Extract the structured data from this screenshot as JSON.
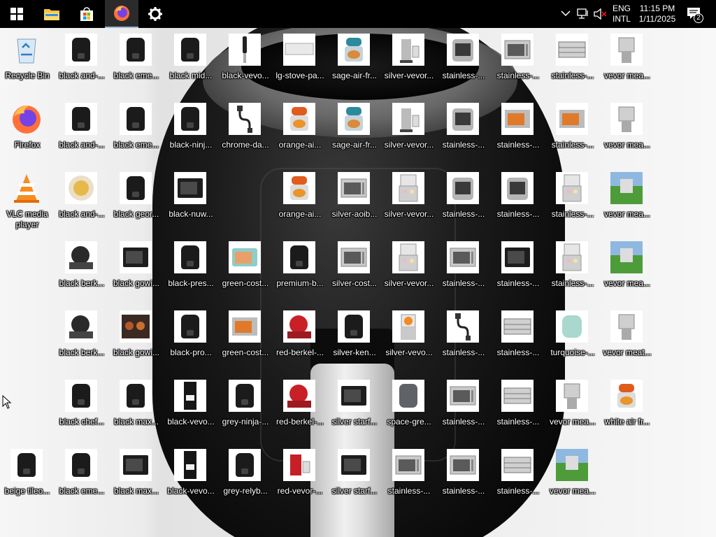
{
  "taskbar": {
    "buttons": [
      {
        "name": "start-button",
        "icon": "windows-logo-icon"
      },
      {
        "name": "file-explorer-button",
        "icon": "folder-icon"
      },
      {
        "name": "microsoft-store-button",
        "icon": "store-bag-icon"
      },
      {
        "name": "firefox-taskbar-button",
        "icon": "firefox-icon",
        "active": true
      },
      {
        "name": "settings-taskbar-button",
        "icon": "gear-icon"
      }
    ],
    "tray": {
      "language_line1": "ENG",
      "language_line2": "INTL",
      "time": "11:15 PM",
      "date": "1/11/2025",
      "notification_count": "2"
    }
  },
  "desktop": {
    "icons": [
      {
        "label": "Recycle Bin",
        "kind": "recycle-bin-icon"
      },
      {
        "label": "black and-...",
        "kind": "black-air-fryer"
      },
      {
        "label": "black eme...",
        "kind": "black-air-fryer"
      },
      {
        "label": "black mid...",
        "kind": "black-air-fryer"
      },
      {
        "label": "black-vevo...",
        "kind": "immersion-blender"
      },
      {
        "label": "lg-stove-pa...",
        "kind": "stove-panel"
      },
      {
        "label": "sage-air-fr...",
        "kind": "teal-air-fryer"
      },
      {
        "label": "silver-vevor...",
        "kind": "silver-distiller"
      },
      {
        "label": "stainless-...",
        "kind": "steel-air-fryer"
      },
      {
        "label": "stainless-...",
        "kind": "steel-oven"
      },
      {
        "label": "stainless-...",
        "kind": "steel-warmer"
      },
      {
        "label": "vevor mea...",
        "kind": "meat-machine"
      },
      {
        "label": "Firefox",
        "kind": "firefox-icon"
      },
      {
        "label": "black and-...",
        "kind": "black-air-fryer"
      },
      {
        "label": "black eme...",
        "kind": "black-air-fryer"
      },
      {
        "label": "black-ninj...",
        "kind": "black-air-fryer"
      },
      {
        "label": "chrome-da...",
        "kind": "cable"
      },
      {
        "label": "orange-ai...",
        "kind": "orange-air-fryer"
      },
      {
        "label": "sage-air-fr...",
        "kind": "teal-air-fryer"
      },
      {
        "label": "silver-vevor...",
        "kind": "silver-distiller"
      },
      {
        "label": "stainless-...",
        "kind": "steel-air-fryer"
      },
      {
        "label": "stainless-...",
        "kind": "orange-oven"
      },
      {
        "label": "stainless-...",
        "kind": "orange-oven"
      },
      {
        "label": "vevor mea...",
        "kind": "meat-machine"
      },
      {
        "label": "VLC media player",
        "kind": "vlc-icon"
      },
      {
        "label": "black and-...",
        "kind": "food-bowl"
      },
      {
        "label": "black geor...",
        "kind": "black-air-fryer"
      },
      {
        "label": "black-nuw...",
        "kind": "black-oven"
      },
      {
        "label": "orange-ai...",
        "kind": "orange-air-fryer"
      },
      {
        "label": "silver-aoib...",
        "kind": "steel-oven"
      },
      {
        "label": "silver-vevor...",
        "kind": "ice-cream-machine"
      },
      {
        "label": "stainless-...",
        "kind": "steel-air-fryer"
      },
      {
        "label": "stainless-...",
        "kind": "steel-air-fryer"
      },
      {
        "label": "stainless-...",
        "kind": "ice-cream-machine"
      },
      {
        "label": "vevor mea...",
        "kind": "green-field"
      },
      {
        "label": "black berk...",
        "kind": "slicer"
      },
      {
        "label": "black gowi...",
        "kind": "black-oven"
      },
      {
        "label": "black-pres...",
        "kind": "black-air-fryer"
      },
      {
        "label": "green-cost...",
        "kind": "teal-oven"
      },
      {
        "label": "premium-b...",
        "kind": "black-air-fryer"
      },
      {
        "label": "silver-cost...",
        "kind": "steel-oven"
      },
      {
        "label": "silver-vevor...",
        "kind": "ice-cream-machine"
      },
      {
        "label": "stainless-...",
        "kind": "steel-oven"
      },
      {
        "label": "stainless-...",
        "kind": "black-oven"
      },
      {
        "label": "stainless-...",
        "kind": "ice-cream-machine"
      },
      {
        "label": "vevor mea...",
        "kind": "green-field"
      },
      {
        "label": "black berk...",
        "kind": "slicer"
      },
      {
        "label": "black gowi...",
        "kind": "food-skewers"
      },
      {
        "label": "black-pro...",
        "kind": "black-air-fryer"
      },
      {
        "label": "green-cost...",
        "kind": "orange-oven"
      },
      {
        "label": "red-berkel-...",
        "kind": "red-slicer"
      },
      {
        "label": "silver-ken...",
        "kind": "black-air-fryer"
      },
      {
        "label": "silver-vevo...",
        "kind": "juicer"
      },
      {
        "label": "stainless-...",
        "kind": "cable"
      },
      {
        "label": "stainless-...",
        "kind": "steel-warmer"
      },
      {
        "label": "turquoise-...",
        "kind": "mint-air-fryer"
      },
      {
        "label": "vevor meat...",
        "kind": "meat-machine"
      },
      {
        "label": "black chef...",
        "kind": "black-air-fryer"
      },
      {
        "label": "black max...",
        "kind": "black-air-fryer"
      },
      {
        "label": "black-vevo...",
        "kind": "water-dispenser"
      },
      {
        "label": "grey-ninja-...",
        "kind": "black-air-fryer"
      },
      {
        "label": "red-berkel-...",
        "kind": "red-slicer"
      },
      {
        "label": "silver starf...",
        "kind": "black-oven"
      },
      {
        "label": "space-gre...",
        "kind": "grey-air-fryer"
      },
      {
        "label": "stainless-...",
        "kind": "steel-oven"
      },
      {
        "label": "stainless-...",
        "kind": "steel-warmer"
      },
      {
        "label": "vevor mea...",
        "kind": "meat-machine"
      },
      {
        "label": "white air fr...",
        "kind": "orange-air-fryer"
      },
      {
        "label": "beige tileo...",
        "kind": "black-air-fryer"
      },
      {
        "label": "black eme...",
        "kind": "black-air-fryer"
      },
      {
        "label": "black max...",
        "kind": "black-oven"
      },
      {
        "label": "black-vevo...",
        "kind": "water-dispenser"
      },
      {
        "label": "grey-relyb...",
        "kind": "black-air-fryer"
      },
      {
        "label": "red-vevor-...",
        "kind": "red-distiller"
      },
      {
        "label": "silver starf...",
        "kind": "black-oven"
      },
      {
        "label": "stainless-...",
        "kind": "steel-oven"
      },
      {
        "label": "stainless-...",
        "kind": "steel-oven"
      },
      {
        "label": "stainless-...",
        "kind": "steel-warmer"
      },
      {
        "label": "vevor mea...",
        "kind": "green-field"
      }
    ]
  },
  "cursor": {
    "icon": "mouse-pointer-icon"
  }
}
